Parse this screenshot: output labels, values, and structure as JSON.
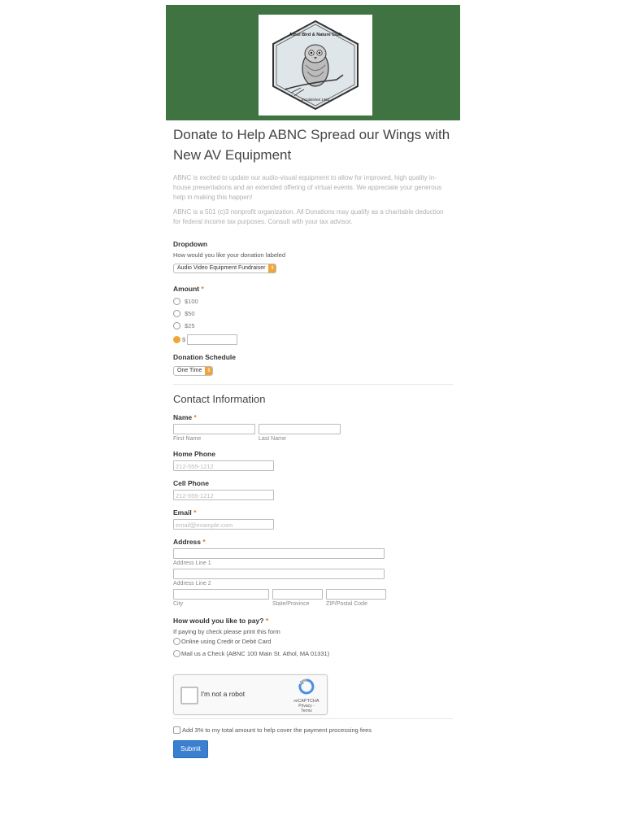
{
  "logo": {
    "name": "Athol Bird & Nature Club",
    "tagline": "Established 1963"
  },
  "page": {
    "title": "Donate to Help ABNC Spread our Wings with New AV Equipment",
    "desc1": "ABNC is excited to update our audio-visual equipment to allow for improved, high quality in-house presentations and an extended offering of virtual events. We appreciate your generous help in making this happen!",
    "desc2": "ABNC is a 501 (c)3 nonprofit organization. All Donations may qualify as a charitable deduction for federal income tax purposes. Consult with your tax advisor."
  },
  "dropdown": {
    "label": "Dropdown",
    "sub": "How would you like your donation labeled",
    "value": "Audio Video Equipment Fundraiser"
  },
  "amount": {
    "label": "Amount",
    "required": "*",
    "options": [
      "$100",
      "$50",
      "$25"
    ],
    "other_prefix": "$",
    "selected": "other"
  },
  "schedule": {
    "label": "Donation Schedule",
    "value": "One Time"
  },
  "contact": {
    "section_title": "Contact Information",
    "name_label": "Name",
    "first_sub": "First Name",
    "last_sub": "Last Name",
    "home_label": "Home Phone",
    "home_placeholder": "212-555-1212",
    "cell_label": "Cell Phone",
    "cell_placeholder": "212-555-1212",
    "email_label": "Email",
    "email_placeholder": "email@example.com",
    "address_label": "Address",
    "addr1_sub": "Address Line 1",
    "addr2_sub": "Address Line 2",
    "city_sub": "City",
    "state_sub": "State/Province",
    "zip_sub": "ZIP/Postal Code"
  },
  "pay": {
    "label": "How would you like to pay?",
    "sub": "If paying by check please print this form",
    "options": [
      "Online using Credit or Debit Card",
      "Mail us a Check (ABNC 100 Main St. Athol, MA 01331)"
    ]
  },
  "captcha": {
    "text": "I'm not a robot",
    "brand": "reCAPTCHA",
    "terms": "Privacy - Terms"
  },
  "fee": {
    "text": "Add 3% to my total amount to help cover the payment processing fees"
  },
  "submit": {
    "label": "Submit"
  },
  "colors": {
    "header_bg": "#3f7442",
    "accent": "#f0a53a",
    "button": "#3a7fd0"
  }
}
